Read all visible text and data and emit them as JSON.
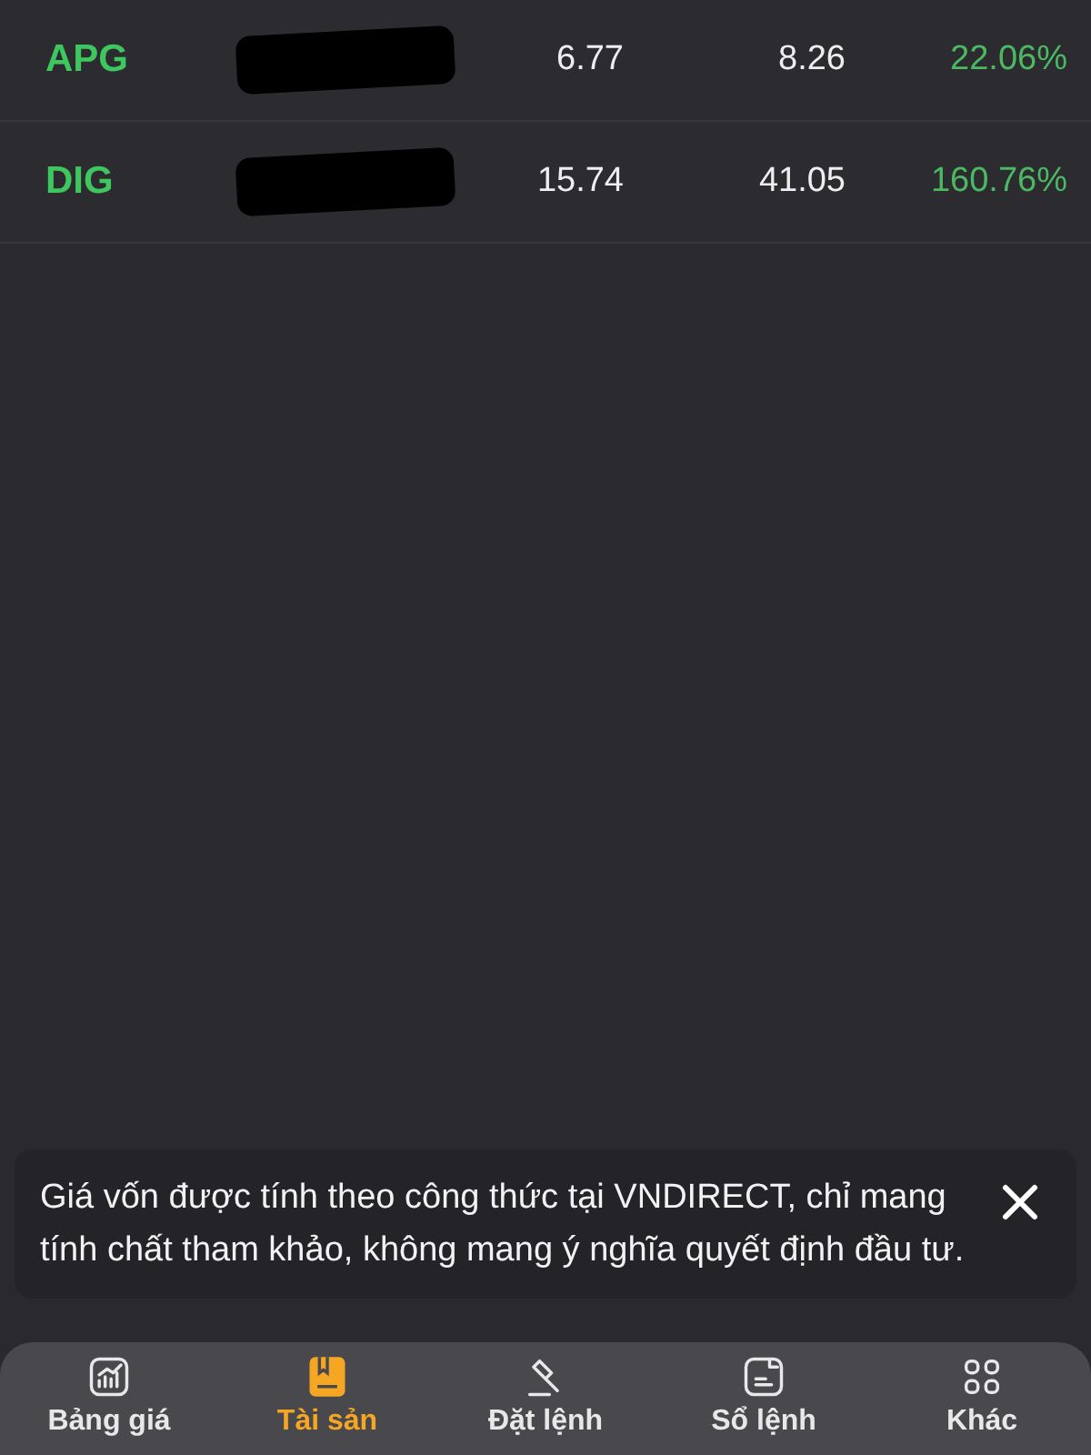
{
  "holdings": [
    {
      "ticker": "APG",
      "redacted": true,
      "column_3": "6.77",
      "column_4": "8.26",
      "change": "22.06%"
    },
    {
      "ticker": "DIG",
      "redacted": true,
      "column_3": "15.74",
      "column_4": "41.05",
      "change": "160.76%"
    }
  ],
  "notice": {
    "text": "Giá vốn được tính theo công thức tại VNDIRECT, chỉ mang tính chất tham khảo, không mang ý nghĩa quyết định đầu tư."
  },
  "nav": [
    {
      "kind": "chart",
      "label": "Bảng giá",
      "selected": false
    },
    {
      "kind": "wallet",
      "label": "Tài sản",
      "selected": true
    },
    {
      "kind": "gavel",
      "label": "Đặt lệnh",
      "selected": false
    },
    {
      "kind": "document",
      "label": "Sổ lệnh",
      "selected": false
    },
    {
      "kind": "grid",
      "label": "Khác",
      "selected": false
    }
  ]
}
